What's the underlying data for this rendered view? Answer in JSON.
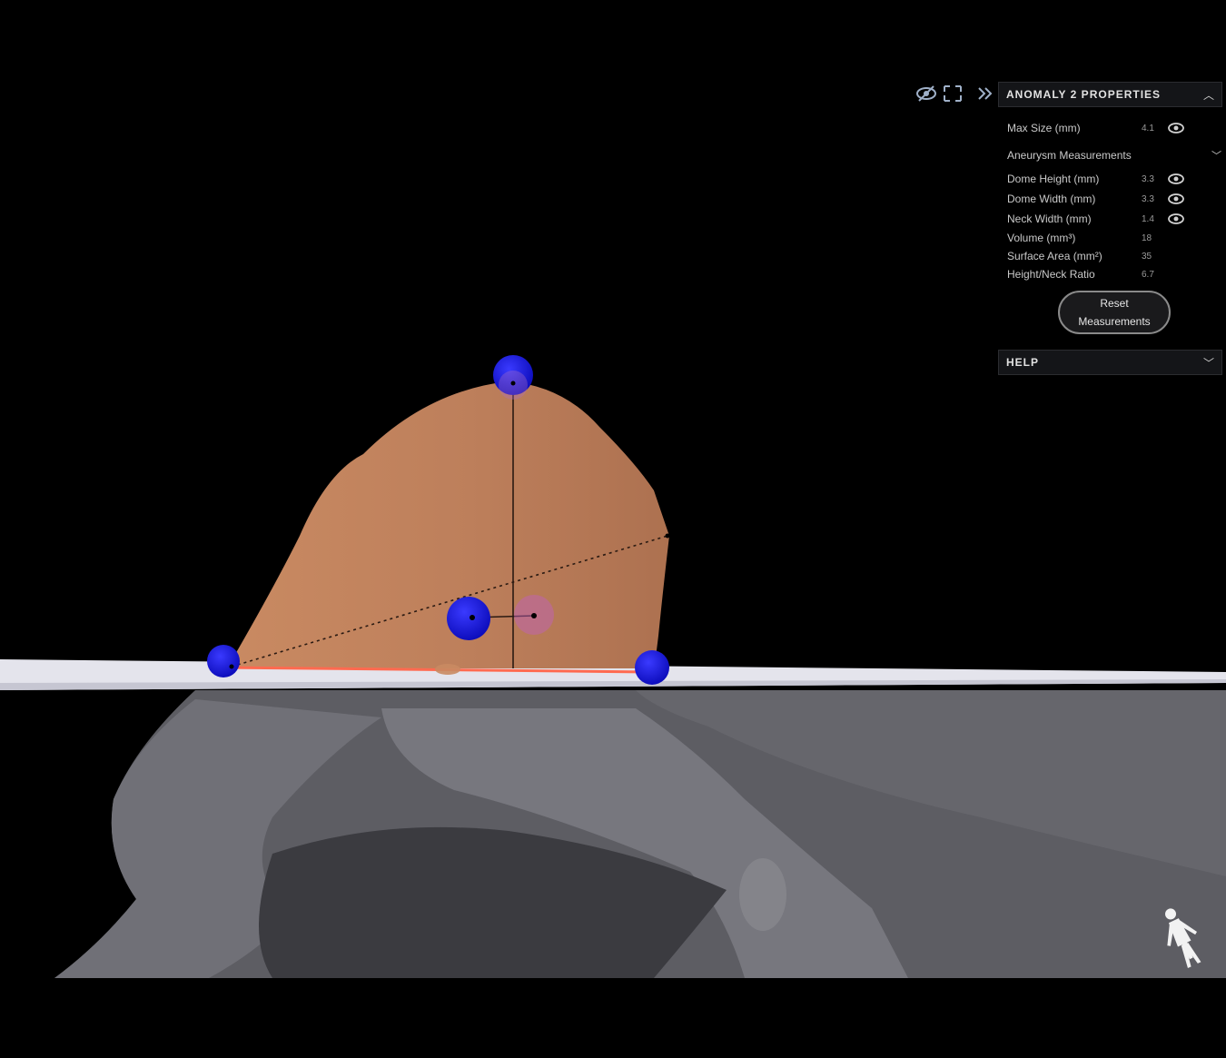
{
  "toolbar": {
    "icons": [
      "eye-slash-icon",
      "expand-icon",
      "double-chevron-right-icon"
    ]
  },
  "properties_panel": {
    "title": "ANOMALY 2 PROPERTIES",
    "max_size": {
      "label": "Max Size (mm)",
      "value": "4.1"
    },
    "section_title": "Aneurysm Measurements",
    "measurements": [
      {
        "label": "Dome Height (mm)",
        "value": "3.3"
      },
      {
        "label": "Dome Width (mm)",
        "value": "3.3"
      },
      {
        "label": "Neck Width (mm)",
        "value": "1.4"
      },
      {
        "label": "Volume (mm³)",
        "value": "18"
      },
      {
        "label": "Surface Area (mm²)",
        "value": "35"
      },
      {
        "label": "Height/Neck Ratio",
        "value": "6.7"
      }
    ],
    "reset_label": "Reset Measurements"
  },
  "help_panel": {
    "title": "HELP"
  },
  "colors": {
    "aneurysm": "#c0825c",
    "handle": "#1212e6",
    "vessel": "#6e6e74",
    "plane": "#e4e4ec",
    "neck_line": "#ff6a50"
  }
}
